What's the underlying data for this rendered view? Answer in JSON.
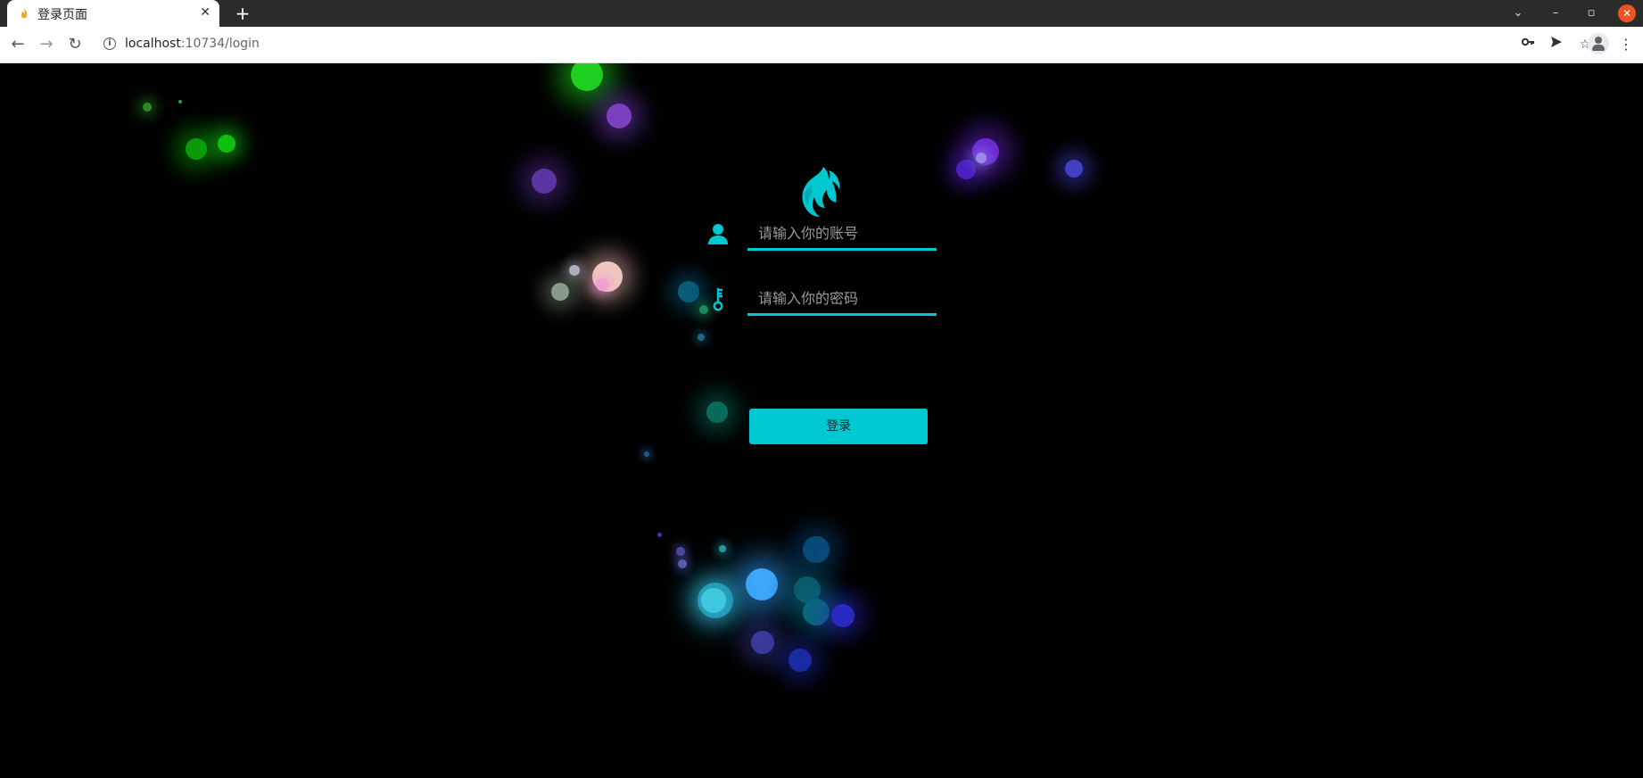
{
  "browser": {
    "tab_title": "登录页面",
    "tab_close": "✕",
    "new_tab": "+",
    "url_host": "localhost",
    "url_rest": ":10734/login",
    "win_minimize": "–",
    "win_restore": "▫",
    "win_close": "✕",
    "tab_dropdown": "⌄"
  },
  "login": {
    "account_placeholder": "请输入你的账号",
    "password_placeholder": "请输入你的密码",
    "button_label": "登录"
  },
  "colors": {
    "accent": "#00c8d0",
    "background": "#000000"
  }
}
